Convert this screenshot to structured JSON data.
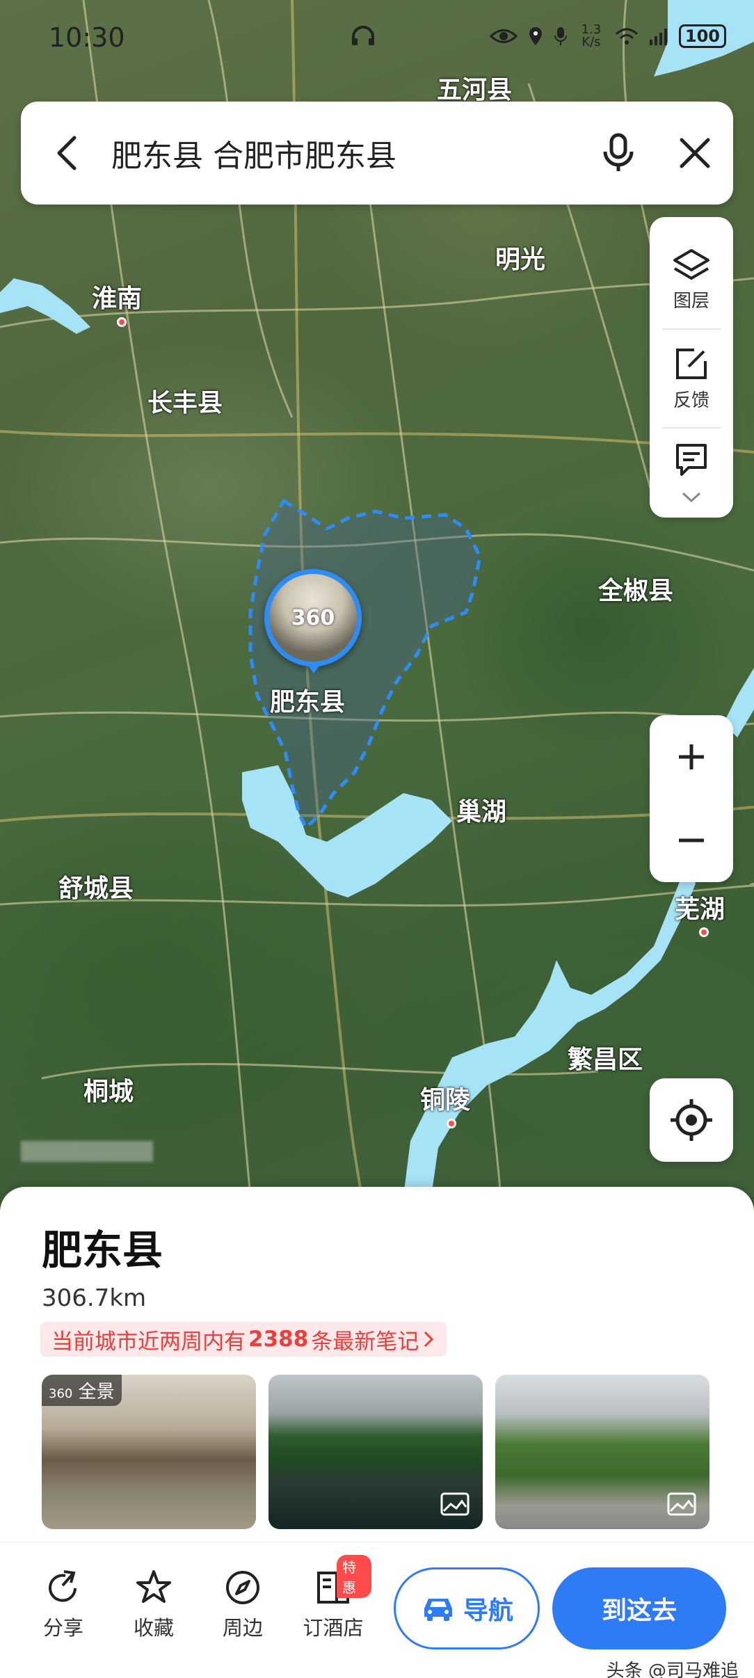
{
  "status_bar": {
    "time": "10:30",
    "net_speed": "1.3 K/s",
    "battery": "100"
  },
  "search": {
    "query": "肥东县 合肥市肥东县"
  },
  "map": {
    "labels": {
      "wuhe": "五河县",
      "huainan": "淮南",
      "mingguang": "明光",
      "changfeng": "长丰县",
      "quanjiao": "全椒县",
      "feidong": "肥东县",
      "chaohu": "巢湖",
      "shucheng": "舒城县",
      "wuhu": "芜湖",
      "fanchang": "繁昌区",
      "tongcheng": "桐城",
      "tongling": "铜陵"
    },
    "pano_label": "360",
    "water_color": "#a6e3f7",
    "boundary_color": "#2f8cf5"
  },
  "tools": {
    "layers": "图层",
    "feedback": "反馈"
  },
  "place": {
    "title": "肥东县",
    "distance": "306.7km",
    "notes_prefix": "当前城市近两周内有",
    "notes_count": "2388",
    "notes_suffix": "条最新笔记",
    "pano_tag": "全景"
  },
  "actions": {
    "share": "分享",
    "favorite": "收藏",
    "nearby": "周边",
    "hotel": "订酒店",
    "hotel_badge": "特惠",
    "navigate": "导航",
    "go_here": "到这去"
  },
  "watermark": "头条 @司马难追",
  "colors": {
    "accent": "#2f7bf5",
    "alert": "#e8403c"
  }
}
